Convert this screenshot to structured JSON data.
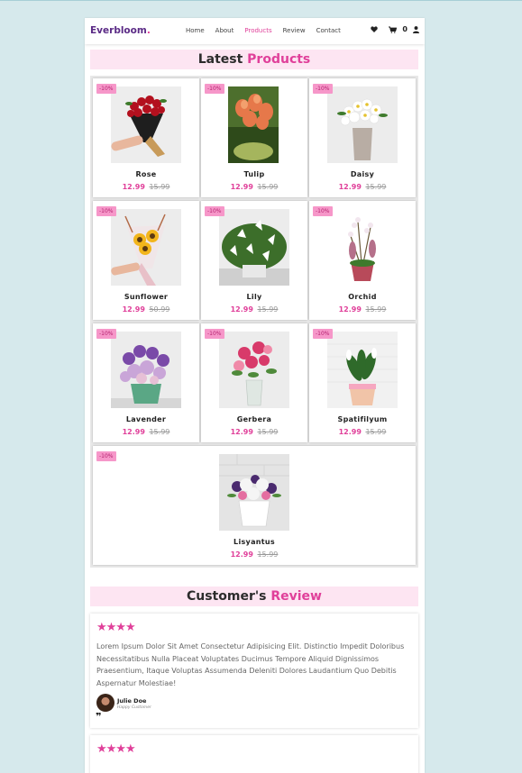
{
  "brand": {
    "name": "Everbloom",
    "dot": "."
  },
  "nav": [
    {
      "label": "Home",
      "active": false
    },
    {
      "label": "About",
      "active": false
    },
    {
      "label": "Products",
      "active": true
    },
    {
      "label": "Review",
      "active": false
    },
    {
      "label": "Contact",
      "active": false
    }
  ],
  "header_icons": {
    "heart": "heart-icon",
    "cart": "cart-icon",
    "cart_count": "0",
    "user": "user-icon"
  },
  "products_section": {
    "title_plain": "Latest ",
    "title_accent": "Products"
  },
  "products": [
    {
      "name": "Rose",
      "price": "12.99",
      "old_price": "15.99",
      "badge": "-10%"
    },
    {
      "name": "Tulip",
      "price": "12.99",
      "old_price": "15.99",
      "badge": "-10%"
    },
    {
      "name": "Daisy",
      "price": "12.99",
      "old_price": "15.99",
      "badge": "-10%"
    },
    {
      "name": "Sunflower",
      "price": "12.99",
      "old_price": "50.99",
      "badge": "-10%"
    },
    {
      "name": "Lily",
      "price": "12.99",
      "old_price": "15.99",
      "badge": "-10%"
    },
    {
      "name": "Orchid",
      "price": "12.99",
      "old_price": "15.99",
      "badge": "-10%"
    },
    {
      "name": "Lavender",
      "price": "12.99",
      "old_price": "15.99",
      "badge": "-10%"
    },
    {
      "name": "Gerbera",
      "price": "12.99",
      "old_price": "15.99",
      "badge": "-10%"
    },
    {
      "name": "Spatifilyum",
      "price": "12.99",
      "old_price": "15.99",
      "badge": "-10%"
    },
    {
      "name": "Lisyantus",
      "price": "12.99",
      "old_price": "15.99",
      "badge": "-10%"
    }
  ],
  "reviews_section": {
    "title_plain": "Customer's ",
    "title_accent": "Review"
  },
  "reviews": [
    {
      "stars": "★★★★",
      "text": "Lorem Ipsum Dolor Sit Amet Consectetur Adipisicing Elit. Distinctio Impedit Doloribus Necessitatibus Nulla Placeat Voluptates Ducimus Tempore Aliquid Dignissimos Praesentium, Itaque Voluptas Assumenda Deleniti Dolores Laudantium Quo Debitis Aspernatur Molestiae!",
      "name": "Julie Doe",
      "role": "Happy Customer",
      "quote": "❞"
    },
    {
      "stars": "★★★★"
    }
  ],
  "colors": {
    "accent": "#e0409a",
    "brand": "#5b2b86",
    "heading_bg": "#fde5f2",
    "badge_bg": "#f697c9",
    "page_bg": "#d6e9ec"
  }
}
